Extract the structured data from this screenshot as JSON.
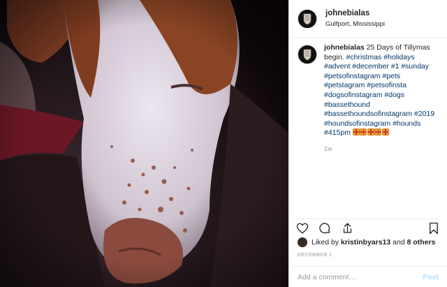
{
  "header": {
    "username": "johnebialas",
    "location": "Gulfport, Mississippi"
  },
  "caption": {
    "username": "johnebialas",
    "text": " 25 Days of Tillymas begin.",
    "hashtags": "#christmas #holidays #advent #december #1 #sunday #petsofinstagram #pets #petstagram #petsofinsta #dogsofinstagram #dogs #bassethound #bassethoundsofinstagram #2019 #houndsofinstagram #hounds #415pm",
    "emoji": "wrapped-gift x5",
    "time_ago": "1w"
  },
  "actions": {
    "like_icon": "heart-icon",
    "comment_icon": "speech-bubble-icon",
    "share_icon": "paper-plane-icon",
    "save_icon": "bookmark-icon"
  },
  "likes": {
    "prefix": "Liked by",
    "user": "kristinbyars13",
    "and": "and",
    "others": "8 others"
  },
  "date": "DECEMBER 1",
  "comment_box": {
    "placeholder": "Add a comment…",
    "post_label": "Post"
  },
  "colors": {
    "hashtag": "#003569",
    "post_button_disabled": "#b2dffc",
    "muted": "#999999"
  }
}
